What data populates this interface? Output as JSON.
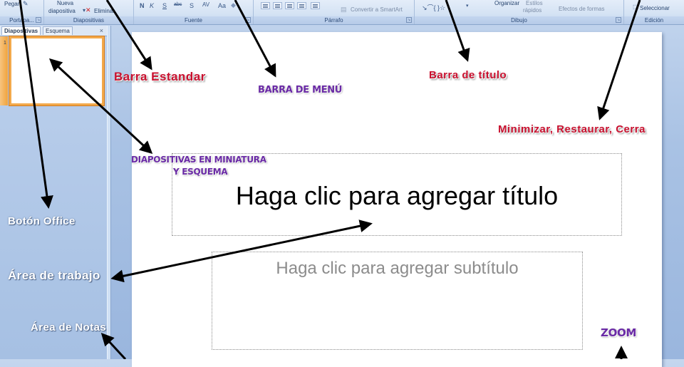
{
  "ribbon": {
    "portapapeles": {
      "label": "Portapa...",
      "pegar": "Pegar"
    },
    "diapositivas": {
      "label": "Diapositivas",
      "nueva_line1": "Nueva",
      "nueva_line2": "diapositiva",
      "eliminar": "Eliminar"
    },
    "fuente": {
      "label": "Fuente",
      "buttons": [
        "N",
        "K",
        "S",
        "abc",
        "S",
        "AV",
        "Aa"
      ]
    },
    "parrafo": {
      "label": "Párrafo",
      "convertir": "Convertir a SmartArt"
    },
    "dibujo": {
      "label": "Dibujo",
      "organizar": "Organizar",
      "estilos_line1": "Estilos",
      "estilos_line2": "rápidos",
      "efectos": "Efectos de formas"
    },
    "edicion": {
      "label": "Edición",
      "seleccionar": "Seleccionar"
    }
  },
  "left_panel": {
    "tabs": [
      "Diapositivas",
      "Esquema"
    ],
    "close": "×",
    "slide_number": "1"
  },
  "slide": {
    "title_placeholder": "Haga clic para agregar título",
    "subtitle_placeholder": "Haga clic para agregar subtítulo"
  },
  "annotations": {
    "barra_estandar": "Barra Estandar",
    "barra_menu": "BARRA DE MENÚ",
    "barra_titulo": "Barra de título",
    "minimizar": "Minimizar, Restaurar, Cerra",
    "miniatura_line1": "DIAPOSITIVAS EN MINIATURA",
    "miniatura_line2": "Y ESQUEMA",
    "boton_office": "Botón Office",
    "area_trabajo": "Área de trabajo",
    "area_notas": "Área  de  Notas",
    "zoom": "ZOOM"
  },
  "colors": {
    "annotation_red": "#c8102e",
    "annotation_purple": "#6a2aa6",
    "annotation_white": "#ffffff",
    "thumbnail_border": "#f3a94b",
    "ribbon_bg": "#d5e3f4",
    "panel_bg": "#a9c2e4"
  }
}
